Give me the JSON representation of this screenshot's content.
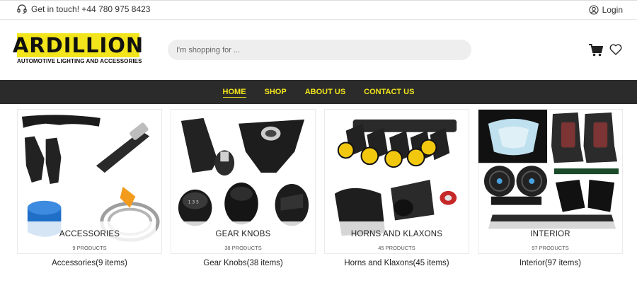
{
  "topbar": {
    "contact_text": "Get in touch! +44 780 975 8423",
    "login_label": "Login"
  },
  "logo": {
    "title": "ARDILLION",
    "subtitle": "AUTOMOTIVE LIGHTING AND ACCESSORIES",
    "brand_color": "#f2e51b"
  },
  "search": {
    "placeholder": "I'm shopping for ..."
  },
  "nav": {
    "items": [
      {
        "label": "HOME",
        "active": true
      },
      {
        "label": "SHOP",
        "active": false
      },
      {
        "label": "ABOUT US",
        "active": false
      },
      {
        "label": "CONTACT US",
        "active": false
      }
    ],
    "bg_color": "#2b2b2b",
    "text_color": "#f2e51b"
  },
  "categories": [
    {
      "name": "ACCESSORIES",
      "count": "9 PRODUCTS",
      "caption": "Accessories(9 items)"
    },
    {
      "name": "GEAR KNOBS",
      "count": "38 PRODUCTS",
      "caption": "Gear Knobs(38 items)"
    },
    {
      "name": "HORNS AND KLAXONS",
      "count": "45 PRODUCTS",
      "caption": "Horns and Klaxons(45 items)"
    },
    {
      "name": "INTERIOR",
      "count": "97 PRODUCTS",
      "caption": "Interior(97 items)"
    }
  ]
}
